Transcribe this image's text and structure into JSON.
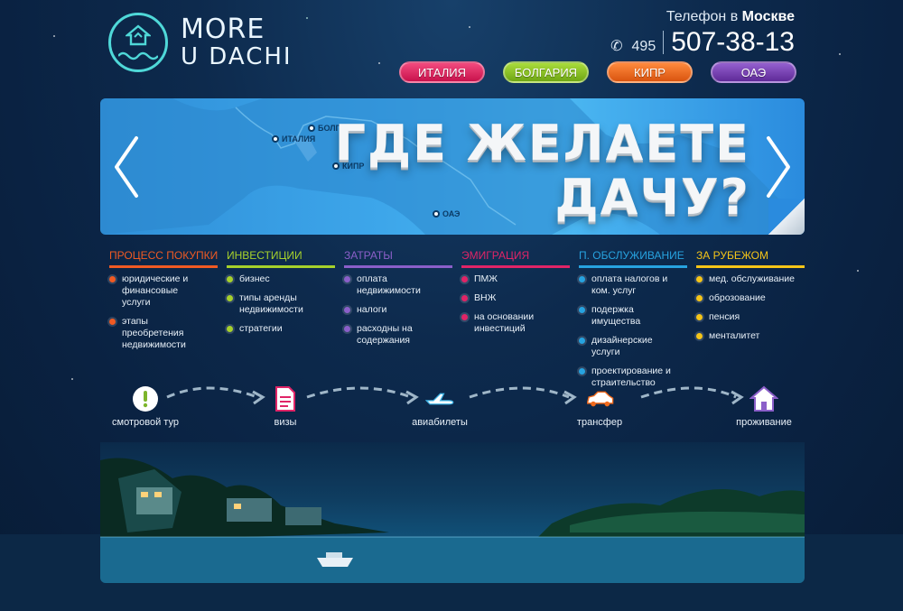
{
  "logo": {
    "line1": "MORE",
    "line2": "U DACHI"
  },
  "phone": {
    "city_prefix": "Телефон в",
    "city": "Москве",
    "code": "495",
    "number": "507-38-13"
  },
  "countries": [
    {
      "label": "ИТАЛИЯ",
      "color": "#e0215f"
    },
    {
      "label": "БОЛГАРИЯ",
      "color": "#8cc21c"
    },
    {
      "label": "КИПР",
      "color": "#f06a1d"
    },
    {
      "label": "ОАЭ",
      "color": "#7a3fb4"
    }
  ],
  "banner": {
    "line1": "ГДЕ ЖЕЛАЕТЕ",
    "line2": "ДАЧУ?",
    "markers": [
      "БОЛГАРИЯ",
      "ИТАЛИЯ",
      "КИПР",
      "ОАЭ"
    ]
  },
  "columns": [
    {
      "title": "ПРОЦЕСС ПОКУПКИ",
      "color": "#f05a23",
      "items": [
        "юридические и финансовые услуги",
        "этапы преобретения недвижимости"
      ]
    },
    {
      "title": "ИНВЕСТИЦИИ",
      "color": "#a6d12b",
      "items": [
        "бизнес",
        "типы аренды недвижимости",
        "стратегии"
      ]
    },
    {
      "title": "ЗАТРАТЫ",
      "color": "#8b5fc9",
      "items": [
        "оплата недвижимости",
        "налоги",
        "расходны на содержания"
      ]
    },
    {
      "title": "ЭМИГРАЦИЯ",
      "color": "#e02467",
      "items": [
        "ПМЖ",
        "ВНЖ",
        "на основании инвестиций"
      ]
    },
    {
      "title": "П. ОБСЛУЖИВАНИЕ",
      "color": "#27a3e0",
      "items": [
        "оплата налогов и ком. услуг",
        "подержка имущества",
        "дизайнерские услуги",
        "проектирование и страительство"
      ]
    },
    {
      "title": "ЗА РУБЕЖОМ",
      "color": "#f5c518",
      "items": [
        "мед. обслуживание",
        "оброзование",
        "пенсия",
        "менталитет"
      ]
    }
  ],
  "steps": [
    {
      "label": "смотровой тур",
      "icon": "exclamation-icon"
    },
    {
      "label": "визы",
      "icon": "document-icon"
    },
    {
      "label": "авиабилеты",
      "icon": "airplane-icon"
    },
    {
      "label": "трансфер",
      "icon": "car-icon"
    },
    {
      "label": "проживание",
      "icon": "house-icon"
    }
  ]
}
